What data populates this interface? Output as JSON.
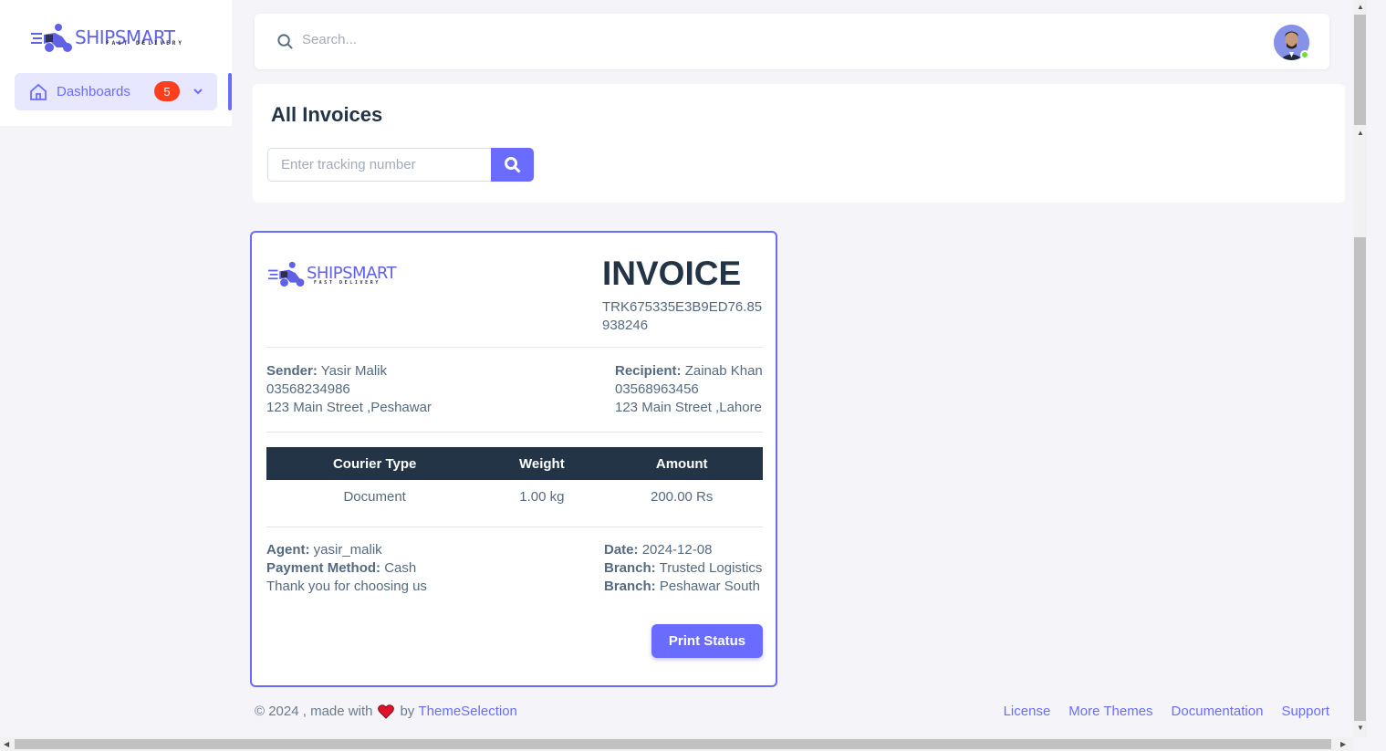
{
  "sidebar": {
    "logo_text": "SHIPSMART",
    "logo_sub": "FAST DELIVERY",
    "menu": {
      "label": "Dashboards",
      "badge": "5"
    }
  },
  "topbar": {
    "search_placeholder": "Search..."
  },
  "page": {
    "title": "All Invoices",
    "tracking_placeholder": "Enter tracking number"
  },
  "invoice": {
    "logo_text": "SHIPSMART",
    "logo_sub": "FAST DELIVERY",
    "title": "INVOICE",
    "tracking": "TRK675335E3B9ED76.85938246",
    "sender": {
      "label": "Sender:",
      "name": "Yasir Malik",
      "phone": "03568234986",
      "address": "123 Main Street ,Peshawar"
    },
    "recipient": {
      "label": "Recipient:",
      "name": "Zainab Khan",
      "phone": "03568963456",
      "address": "123 Main Street ,Lahore"
    },
    "table": {
      "headers": [
        "Courier Type",
        "Weight",
        "Amount"
      ],
      "row": [
        "Document",
        "1.00 kg",
        "200.00 Rs"
      ]
    },
    "agent": {
      "label": "Agent:",
      "value": "yasir_malik"
    },
    "payment": {
      "label": "Payment Method:",
      "value": "Cash"
    },
    "thanks": "Thank you for choosing us",
    "date": {
      "label": "Date:",
      "value": "2024-12-08"
    },
    "branch1": {
      "label": "Branch:",
      "value": "Trusted Logistics"
    },
    "branch2": {
      "label": "Branch:",
      "value": "Peshawar South"
    },
    "print_label": "Print Status"
  },
  "footer": {
    "prefix": "© 2024 , made with",
    "by": "by",
    "brand": "ThemeSelection",
    "links": [
      "License",
      "More Themes",
      "Documentation",
      "Support"
    ]
  },
  "colors": {
    "accent": "#696cff",
    "dark": "#233446",
    "badge": "#ff3e1d"
  }
}
